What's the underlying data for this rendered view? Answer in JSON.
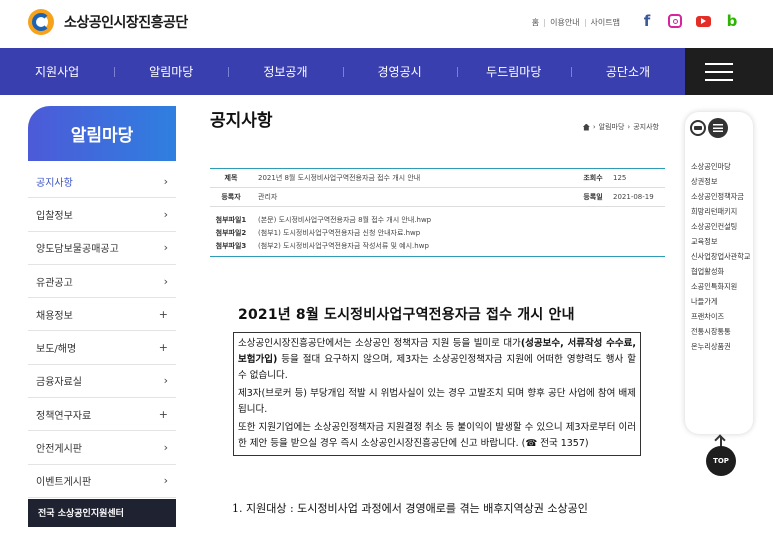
{
  "header": {
    "logo_text": "소상공인시장진흥공단",
    "util_links": [
      "홈",
      "이용안내",
      "사이트맵"
    ],
    "sns": [
      {
        "name": "facebook-icon",
        "glyph": "f"
      },
      {
        "name": "instagram-icon",
        "glyph": ""
      },
      {
        "name": "youtube-icon",
        "glyph": ""
      },
      {
        "name": "blog-icon",
        "glyph": "b"
      }
    ]
  },
  "nav": {
    "items": [
      "지원사업",
      "알림마당",
      "정보공개",
      "경영공시",
      "두드림마당",
      "공단소개"
    ]
  },
  "sidebar": {
    "title": "알림마당",
    "items": [
      {
        "label": "공지사항",
        "marker": "›"
      },
      {
        "label": "입찰정보",
        "marker": "›"
      },
      {
        "label": "양도담보물공매공고",
        "marker": "›"
      },
      {
        "label": "유관공고",
        "marker": "›"
      },
      {
        "label": "채용정보",
        "marker": "+"
      },
      {
        "label": "보도/해명",
        "marker": "+"
      },
      {
        "label": "금융자료실",
        "marker": "›"
      },
      {
        "label": "정책연구자료",
        "marker": "+"
      },
      {
        "label": "안전게시판",
        "marker": "›"
      },
      {
        "label": "이벤트게시판",
        "marker": "›"
      }
    ],
    "center_label": "전국 소상공인지원센터"
  },
  "main": {
    "page_title": "공지사항",
    "breadcrumb": [
      "알림마당",
      "공지사항"
    ],
    "info": {
      "title_label": "제목",
      "title_value": "2021년 8월 도시정비사업구역전용자금 접수 개시 안내",
      "views_label": "조회수",
      "views_value": "125",
      "author_label": "등록자",
      "author_value": "관리자",
      "date_label": "등록일",
      "date_value": "2021-08-19"
    },
    "files": [
      {
        "label": "첨부파일1",
        "value": "(본문) 도시정비사업구역전용자금 8월 접수 개시 안내.hwp"
      },
      {
        "label": "첨부파일2",
        "value": "(첨부1) 도시정비사업구역전용자금 신청 안내자료.hwp"
      },
      {
        "label": "첨부파일3",
        "value": "(첨부2) 도시정비사업구역전용자금 작성서류 및 예시.hwp"
      }
    ],
    "doc_title": "2021년 8월 도시정비사업구역전용자금 접수 개시 안내",
    "notice": {
      "p1_a": "소상공인시장진흥공단에서는 소상공인 정책자금 지원 등을 빌미로 대가",
      "p1_b": "(성공보수, 서류작성 수수료, 보험가입)",
      "p1_c": " 등을 절대 요구하지 않으며, 제3자는 소상공인정책자금 지원에 어떠한 영향력도 행사 할 수 없습니다.",
      "p2": "제3자(브로커 등) 부당개입 적발 시 위법사실이 있는 경우 고발조치 되며 향후 공단 사업에 참여 배제됩니다.",
      "p3": "또한 지원기업에는 소상공인정책자금 지원결정 취소 등 불이익이 발생할 수 있으니 제3자로부터 이러한 제안 등을 받으실 경우 즉시 소상공인시장진흥공단에 신고 바랍니다. (☎ 전국 1357)"
    },
    "item1": "1.  지원대상 : 도시정비사업 과정에서 경영애로를 겪는 배후지역상권 소상공인"
  },
  "quick": {
    "items": [
      "소상공인마당",
      "상권정보",
      "소상공인정책자금",
      "희망리턴패키지",
      "소상공인컨설팅",
      "교육정보",
      "신사업창업사관학교",
      "협업활성화",
      "소공인특화지원",
      "나들가게",
      "프랜차이즈",
      "전통시장통통",
      "온누리상품권"
    ],
    "top_label": "TOP"
  }
}
